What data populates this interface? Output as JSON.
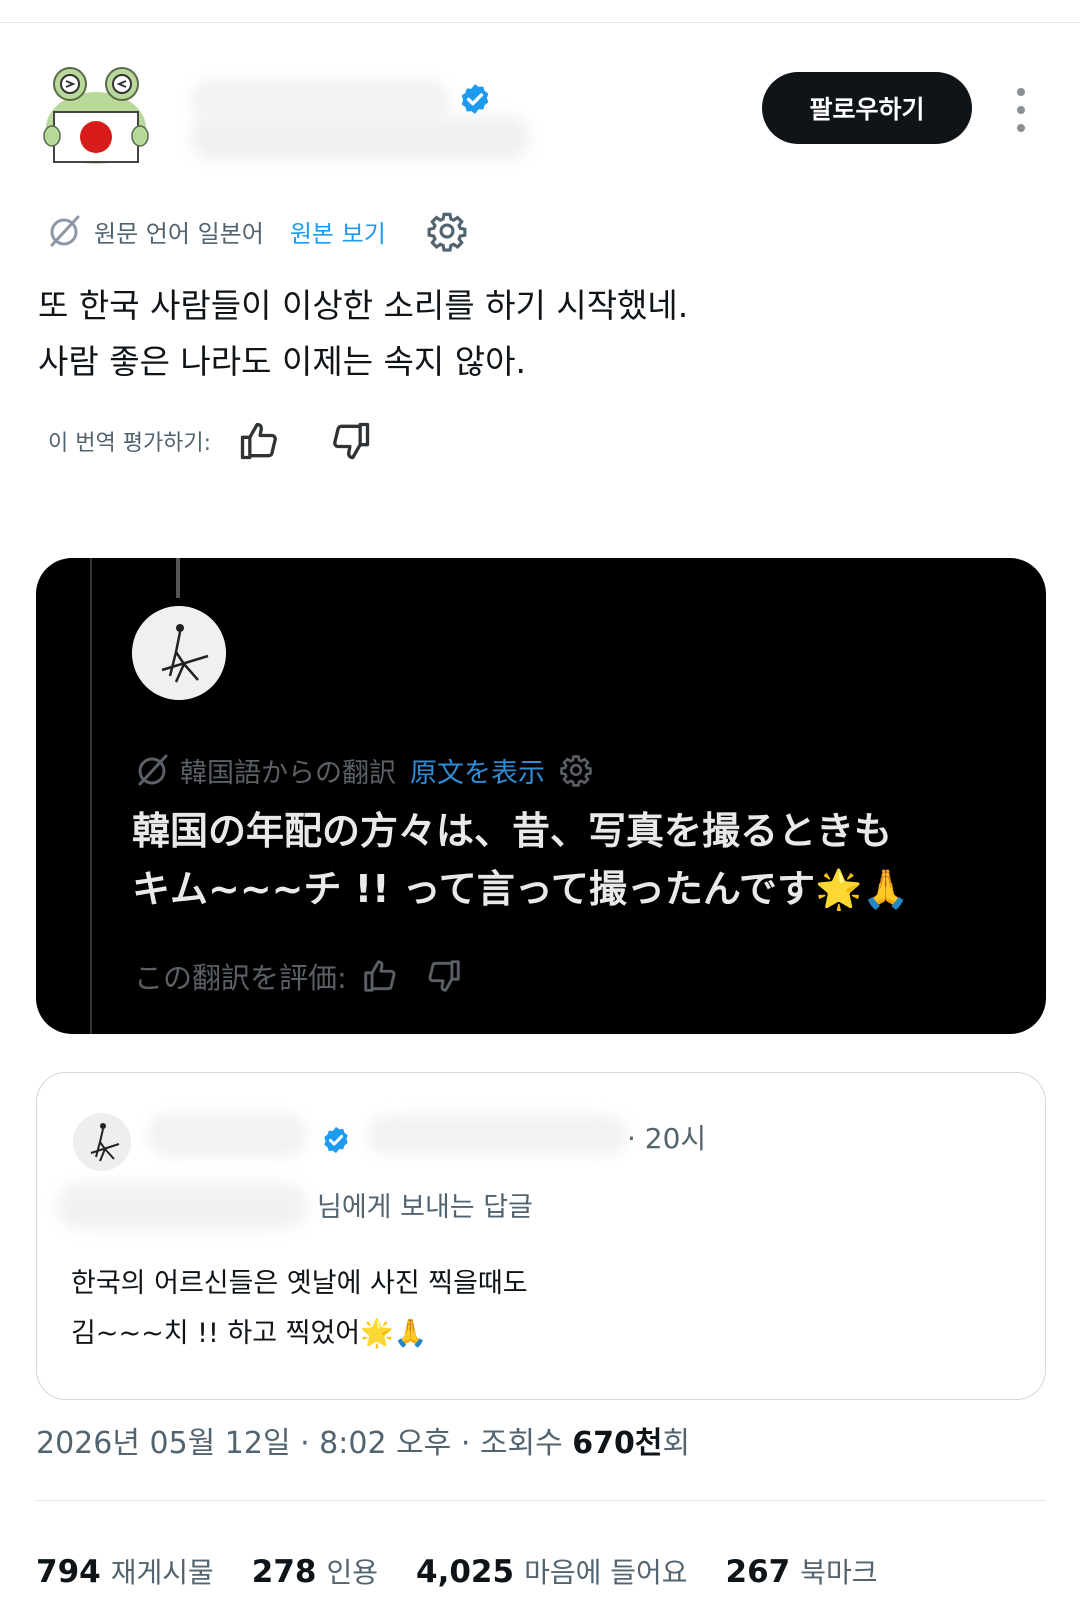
{
  "header": {
    "follow_label": "팔로우하기"
  },
  "translation": {
    "label": "원문 언어 일본어",
    "link": "원본 보기"
  },
  "tweet": {
    "lines": [
      "또 한국 사람들이 이상한 소리를 하기 시작했네.",
      "사람 좋은 나라도 이제는 속지 않아."
    ]
  },
  "rating": {
    "label": "이 번역 평가하기:"
  },
  "embedded_image": {
    "trans_label": "韓国語からの翻訳",
    "trans_link": "原文を表示",
    "lines": [
      "韓国の年配の方々は、昔、写真を撮るときも",
      "キム~~~チ !! って言って撮ったんです🌟🙏"
    ],
    "rate_label": "この翻訳を評価:"
  },
  "quoted_reply": {
    "time": "· 20시",
    "reply_to": "님에게 보내는 답글",
    "lines": [
      "한국의 어르신들은 옛날에 사진 찍을때도",
      "김~~~치 !! 하고 찍었어🌟🙏"
    ]
  },
  "meta": {
    "date": "2026년 05월 12일 · 8:02 오후 · 조회수 ",
    "views_num": "670천",
    "views_suffix": "회"
  },
  "stats": [
    {
      "num": "794",
      "label": "재게시물"
    },
    {
      "num": "278",
      "label": "인용"
    },
    {
      "num": "4,025",
      "label": "마음에 들어요"
    },
    {
      "num": "267",
      "label": "북마크"
    }
  ],
  "colors": {
    "accent": "#1d9bf0",
    "text": "#0f1419",
    "muted": "#536471"
  }
}
